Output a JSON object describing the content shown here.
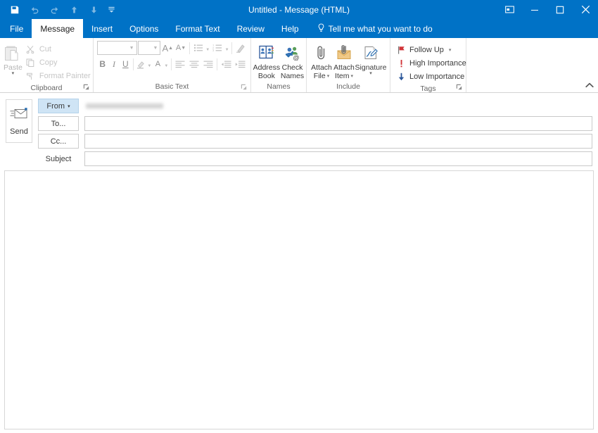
{
  "window": {
    "title": "Untitled  -  Message (HTML)",
    "quick_access": [
      {
        "name": "save-icon",
        "label": "Save",
        "enabled": true
      },
      {
        "name": "undo-icon",
        "label": "Undo",
        "enabled": false
      },
      {
        "name": "redo-icon",
        "label": "Redo",
        "enabled": false
      },
      {
        "name": "previous-item-icon",
        "label": "Previous Item",
        "enabled": false
      },
      {
        "name": "next-item-icon",
        "label": "Next Item",
        "enabled": false
      },
      {
        "name": "customize-quick-access-icon",
        "label": "Customize Quick Access Toolbar",
        "enabled": true
      }
    ],
    "controls": {
      "ribbon_display_options": "Ribbon Display Options",
      "minimize": "Minimize",
      "maximize": "Maximize",
      "close": "Close"
    },
    "accent_color": "#0072c6"
  },
  "tabs": [
    {
      "label": "File",
      "active": false
    },
    {
      "label": "Message",
      "active": true
    },
    {
      "label": "Insert",
      "active": false
    },
    {
      "label": "Options",
      "active": false
    },
    {
      "label": "Format Text",
      "active": false
    },
    {
      "label": "Review",
      "active": false
    },
    {
      "label": "Help",
      "active": false
    }
  ],
  "tell_me": {
    "label": "Tell me what you want to do",
    "icon": "lightbulb-icon"
  },
  "ribbon": {
    "collapse_label": "Collapse the Ribbon",
    "groups": {
      "clipboard": {
        "label": "Clipboard",
        "paste": {
          "label": "Paste",
          "caret": "▾"
        },
        "items": [
          {
            "label": "Cut",
            "icon": "scissors-icon"
          },
          {
            "label": "Copy",
            "icon": "copy-icon"
          },
          {
            "label": "Format Painter",
            "icon": "format-painter-icon"
          }
        ],
        "launcher": "◪"
      },
      "basic_text": {
        "label": "Basic Text",
        "font_name": {
          "value": "",
          "placeholder": ""
        },
        "font_size": {
          "value": "",
          "placeholder": ""
        },
        "grow_font": "A",
        "shrink_font": "A",
        "buttons_row1": [
          {
            "label": "Bullets",
            "icon": "bullets-icon"
          },
          {
            "label": "Numbering",
            "icon": "numbering-icon"
          },
          {
            "label": "Clear All Formatting",
            "icon": "clear-formatting-icon"
          }
        ],
        "bold": "B",
        "italic": "I",
        "underline": "U",
        "buttons_row2": [
          {
            "label": "Text Highlight Color",
            "icon": "highlight-icon"
          },
          {
            "label": "Font Color",
            "icon": "font-color-icon"
          },
          {
            "label": "Align Left",
            "icon": "align-left-icon"
          },
          {
            "label": "Center",
            "icon": "align-center-icon"
          },
          {
            "label": "Align Right",
            "icon": "align-right-icon"
          },
          {
            "label": "Decrease Indent",
            "icon": "decrease-indent-icon"
          },
          {
            "label": "Increase Indent",
            "icon": "increase-indent-icon"
          }
        ],
        "launcher": "◪"
      },
      "names": {
        "label": "Names",
        "items": [
          {
            "label_line1": "Address",
            "label_line2": "Book",
            "icon": "address-book-icon"
          },
          {
            "label_line1": "Check",
            "label_line2": "Names",
            "icon": "check-names-icon"
          }
        ]
      },
      "include": {
        "label": "Include",
        "items": [
          {
            "label_line1": "Attach",
            "label_line2": "File",
            "icon": "paperclip-icon",
            "caret": "▾"
          },
          {
            "label_line1": "Attach",
            "label_line2": "Item",
            "icon": "attach-item-icon",
            "caret": "▾"
          },
          {
            "label_line1": "Signature",
            "label_line2": "",
            "icon": "signature-icon",
            "caret": "▾"
          }
        ]
      },
      "tags": {
        "label": "Tags",
        "items": [
          {
            "label": "Follow Up",
            "icon": "flag-icon",
            "color": "#d13438",
            "caret": "▾"
          },
          {
            "label": "High Importance",
            "icon": "exclamation-icon",
            "color": "#d13438",
            "caret": ""
          },
          {
            "label": "Low Importance",
            "icon": "down-arrow-icon",
            "color": "#2b579a",
            "caret": ""
          }
        ],
        "launcher": "◪"
      }
    }
  },
  "compose": {
    "send_button": {
      "label": "Send",
      "icon": "send-envelope-icon"
    },
    "from": {
      "label": "From",
      "caret": "▾",
      "value_redacted": true
    },
    "to": {
      "label": "To...",
      "value": "",
      "placeholder": ""
    },
    "cc": {
      "label": "Cc...",
      "value": "",
      "placeholder": ""
    },
    "subject": {
      "label": "Subject",
      "value": "",
      "placeholder": ""
    },
    "body": {
      "value": "",
      "placeholder": ""
    }
  }
}
